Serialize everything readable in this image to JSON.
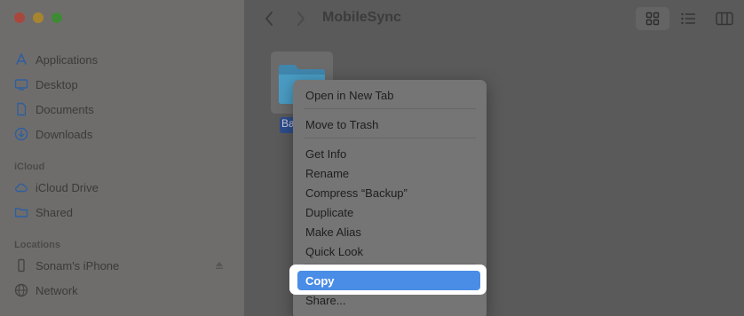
{
  "window": {
    "title": "MobileSync"
  },
  "sidebar": {
    "favorites": [
      {
        "label": "Applications",
        "icon": "applications-icon"
      },
      {
        "label": "Desktop",
        "icon": "desktop-icon"
      },
      {
        "label": "Documents",
        "icon": "document-icon"
      },
      {
        "label": "Downloads",
        "icon": "download-icon"
      }
    ],
    "icloud_heading": "iCloud",
    "icloud": [
      {
        "label": "iCloud Drive",
        "icon": "cloud-icon"
      },
      {
        "label": "Shared",
        "icon": "shared-folder-icon"
      }
    ],
    "locations_heading": "Locations",
    "locations": [
      {
        "label": "Sonam's iPhone",
        "icon": "iphone-icon"
      },
      {
        "label": "Network",
        "icon": "network-icon"
      }
    ]
  },
  "content": {
    "folder_label": "Ba"
  },
  "context_menu": {
    "items": [
      "Open in New Tab",
      "Move to Trash",
      "Get Info",
      "Rename",
      "Compress “Backup”",
      "Duplicate",
      "Make Alias",
      "Quick Look",
      "Copy",
      "Share..."
    ],
    "highlighted": "Copy"
  },
  "colors": {
    "highlight": "#4a8de6",
    "sidebar_accent": "#2f5f9e",
    "folder": "#4a9cc4"
  }
}
